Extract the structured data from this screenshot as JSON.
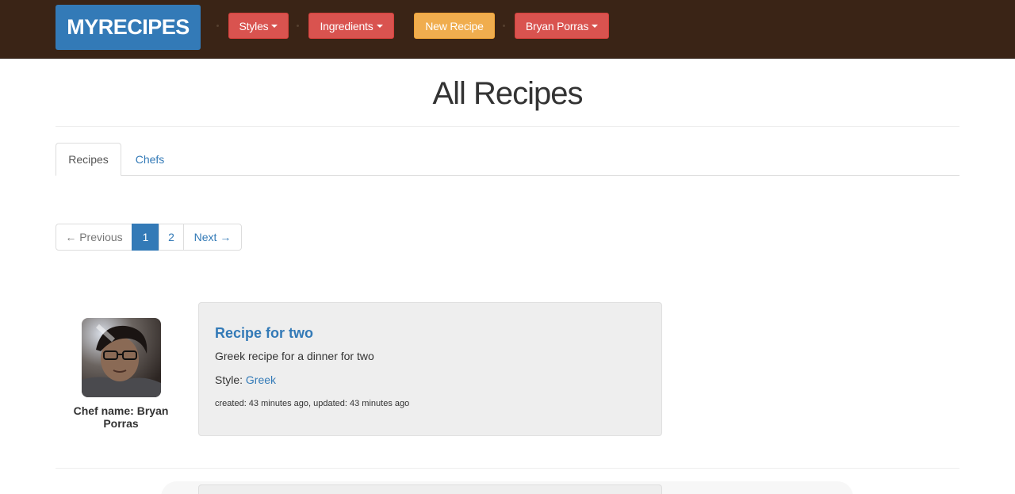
{
  "navbar": {
    "brand": "MYRECIPES",
    "styles": "Styles",
    "ingredients": "Ingredients",
    "new_recipe": "New Recipe",
    "user": "Bryan Porras",
    "colors": {
      "bg": "#3a2416",
      "brand": "#337ab7",
      "danger": "#d9534f",
      "warning": "#f0ad4e"
    }
  },
  "page": {
    "title": "All Recipes"
  },
  "tabs": [
    {
      "label": "Recipes",
      "active": true
    },
    {
      "label": "Chefs",
      "active": false
    }
  ],
  "pagination": {
    "previous": "← Previous",
    "pages": [
      "1",
      "2"
    ],
    "current": "1",
    "next": "Next →"
  },
  "recipe": {
    "chef_name": "Chef name: Bryan Porras",
    "title": "Recipe for two",
    "description": "Greek recipe for a dinner for two",
    "style_label": "Style:",
    "style_value": "Greek",
    "meta": "created: 43 minutes ago, updated: 43 minutes ago"
  }
}
